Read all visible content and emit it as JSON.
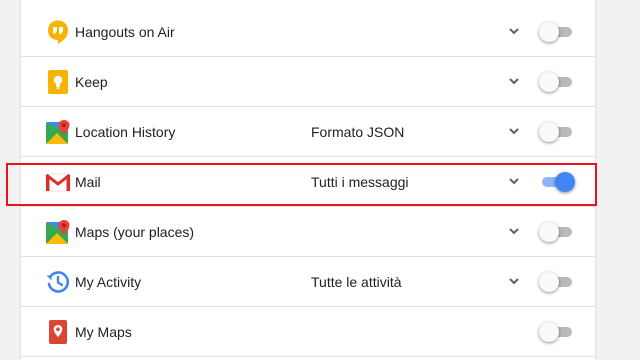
{
  "rows": [
    {
      "name": "Hangouts on Air",
      "format": "",
      "icon": "hangouts-icon",
      "enabled": false
    },
    {
      "name": "Keep",
      "format": "",
      "icon": "keep-icon",
      "enabled": false
    },
    {
      "name": "Location History",
      "format": "Formato JSON",
      "icon": "location-history-icon",
      "enabled": false
    },
    {
      "name": "Mail",
      "format": "Tutti i messaggi",
      "icon": "gmail-icon",
      "enabled": true
    },
    {
      "name": "Maps (your places)",
      "format": "",
      "icon": "maps-icon",
      "enabled": false
    },
    {
      "name": "My Activity",
      "format": "Tutte le attività",
      "icon": "my-activity-icon",
      "enabled": false
    },
    {
      "name": "My Maps",
      "format": "",
      "icon": "my-maps-icon",
      "enabled": false
    }
  ],
  "highlight": {
    "target": "Mail",
    "color": "#e8141c"
  },
  "colors": {
    "toggle_on": "#4285f4",
    "toggle_off": "#b9b9b9"
  }
}
